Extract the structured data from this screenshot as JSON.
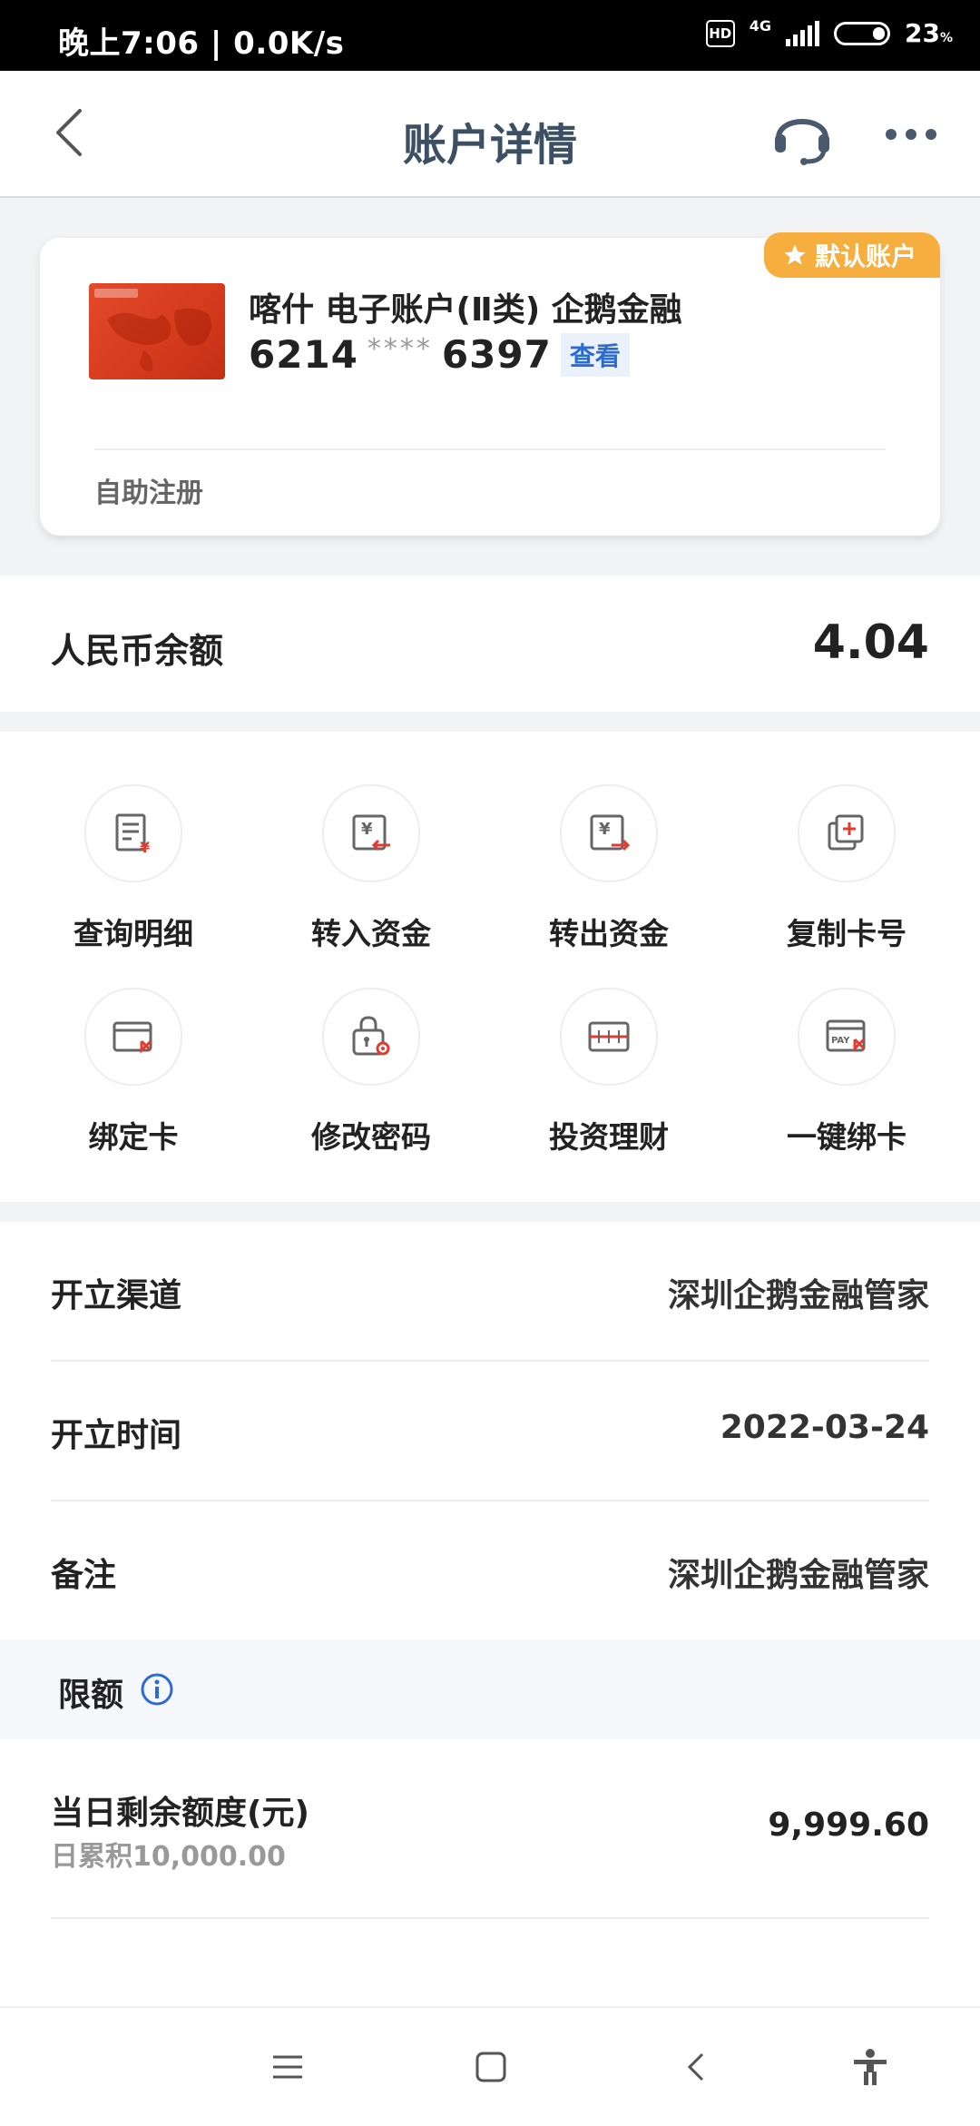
{
  "status_bar": {
    "time_speed": "晚上7:06 | 0.0K/s",
    "hd": "HD",
    "network": "4G",
    "battery": "23",
    "battery_unit": "%"
  },
  "header": {
    "title": "账户详情"
  },
  "account": {
    "default_tag": "默认账户",
    "name": "喀什 电子账户(Ⅱ类) 企鹅金融",
    "number_prefix": "6214",
    "number_mask": "****",
    "number_suffix": "6397",
    "view_label": "查看",
    "footer": "自助注册"
  },
  "balance": {
    "label": "人民币余额",
    "value": "4.04"
  },
  "functions": [
    {
      "label": "查询明细",
      "icon": "bill-detail-icon"
    },
    {
      "label": "转入资金",
      "icon": "transfer-in-icon"
    },
    {
      "label": "转出资金",
      "icon": "transfer-out-icon"
    },
    {
      "label": "复制卡号",
      "icon": "copy-card-icon"
    },
    {
      "label": "绑定卡",
      "icon": "bind-card-icon"
    },
    {
      "label": "修改密码",
      "icon": "password-lock-icon"
    },
    {
      "label": "投资理财",
      "icon": "invest-icon"
    },
    {
      "label": "一键绑卡",
      "icon": "pay-card-icon"
    }
  ],
  "info": [
    {
      "key": "开立渠道",
      "value": "深圳企鹅金融管家"
    },
    {
      "key": "开立时间",
      "value": "2022-03-24"
    },
    {
      "key": "备注",
      "value": "深圳企鹅金融管家"
    }
  ],
  "limit": {
    "header": "限额",
    "daily_label": "当日剩余额度(元)",
    "daily_sub": "日累积10,000.00",
    "daily_value": "9,999.60"
  },
  "colors": {
    "accent_blue": "#2b6bd2",
    "default_tag": "#f6ae3f",
    "icon_red": "#e03c31",
    "title": "#3d4f63"
  }
}
